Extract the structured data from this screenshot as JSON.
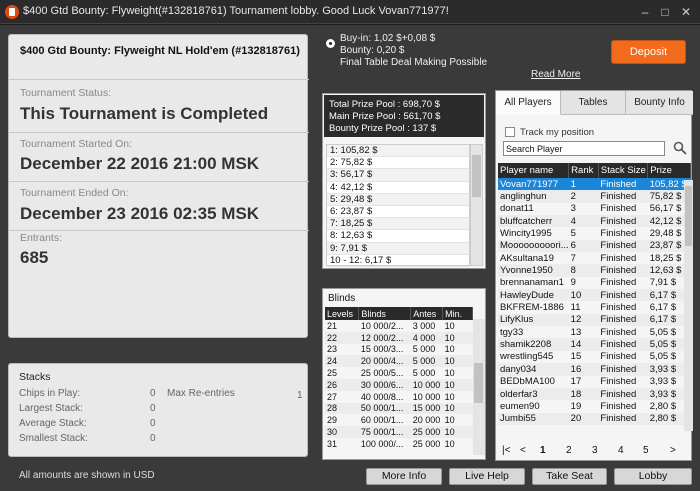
{
  "window": {
    "title": "$400 Gtd Bounty: Flyweight(#132818761) Tournament lobby. Good Luck Vovan771977!",
    "minimize": "–",
    "maximize": "□",
    "close": "✕"
  },
  "tournament": {
    "name": "$400 Gtd Bounty: Flyweight NL Hold'em (#132818761)",
    "status_label": "Tournament Status:",
    "status_value": "This Tournament is Completed",
    "started_label": "Tournament Started On:",
    "started_value": "December 22 2016   21:00 MSK",
    "ended_label": "Tournament Ended On:",
    "ended_value": "December 23 2016   02:35 MSK",
    "entrants_label": "Entrants:",
    "entrants_value": "685"
  },
  "stacks": {
    "title": "Stacks",
    "rows": [
      {
        "label": "Chips in Play:",
        "value": "0"
      },
      {
        "label": "Largest Stack:",
        "value": "0"
      },
      {
        "label": "Average Stack:",
        "value": "0"
      },
      {
        "label": "Smallest Stack:",
        "value": "0"
      }
    ],
    "max_reentries_label": "Max Re-entries",
    "max_reentries_value": "1"
  },
  "footer_note": "All amounts are shown in USD",
  "buttons": {
    "more_info": "More Info",
    "live_help": "Live Help",
    "take_seat": "Take Seat",
    "lobby": "Lobby",
    "deposit": "Deposit",
    "read_more": "Read More"
  },
  "buyin": {
    "line1": "Buy-in: 1,02 $+0,08 $",
    "line2": "Bounty: 0,20 $",
    "line3": "Final Table Deal Making Possible"
  },
  "prize": {
    "total": "Total Prize Pool : 698,70 $",
    "main": "Main Prize Pool : 561,70 $",
    "bounty": "Bounty Prize Pool : 137 $",
    "places": [
      "1: 105,82 $",
      "2: 75,82 $",
      "3: 56,17 $",
      "4: 42,12 $",
      "5: 29,48 $",
      "6: 23,87 $",
      "7: 18,25 $",
      "8: 12,63 $",
      "9: 7,91 $",
      "10 - 12: 6,17 $"
    ]
  },
  "blinds": {
    "title": "Blinds",
    "headers": [
      "Levels",
      "Blinds",
      "Antes",
      "Min."
    ],
    "rows": [
      [
        "21",
        "10 000/2...",
        "3 000",
        "10"
      ],
      [
        "22",
        "12 000/2...",
        "4 000",
        "10"
      ],
      [
        "23",
        "15 000/3...",
        "5 000",
        "10"
      ],
      [
        "24",
        "20 000/4...",
        "5 000",
        "10"
      ],
      [
        "25",
        "25 000/5...",
        "5 000",
        "10"
      ],
      [
        "26",
        "30 000/6...",
        "10 000",
        "10"
      ],
      [
        "27",
        "40 000/8...",
        "10 000",
        "10"
      ],
      [
        "28",
        "50 000/1...",
        "15 000",
        "10"
      ],
      [
        "29",
        "60 000/1...",
        "20 000",
        "10"
      ],
      [
        "30",
        "75 000/1...",
        "25 000",
        "10"
      ],
      [
        "31",
        "100 000/...",
        "25 000",
        "10"
      ]
    ]
  },
  "players_panel": {
    "tabs": [
      "All Players",
      "Tables",
      "Bounty Info"
    ],
    "track_label": "Track my position",
    "search_placeholder": "Search Player",
    "headers": [
      "Player name",
      "Rank",
      "Stack Size",
      "Prize"
    ],
    "rows": [
      [
        "Vovan771977",
        "1",
        "Finished",
        "105,82 $"
      ],
      [
        "anglinghun",
        "2",
        "Finished",
        "75,82 $"
      ],
      [
        "donat11",
        "3",
        "Finished",
        "56,17 $"
      ],
      [
        "bluffcatcherr",
        "4",
        "Finished",
        "42,12 $"
      ],
      [
        "Wincity1995",
        "5",
        "Finished",
        "29,48 $"
      ],
      [
        "Mooooooooori...",
        "6",
        "Finished",
        "23,87 $"
      ],
      [
        "AKsultana19",
        "7",
        "Finished",
        "18,25 $"
      ],
      [
        "Yvonne1950",
        "8",
        "Finished",
        "12,63 $"
      ],
      [
        "brennanaman1",
        "9",
        "Finished",
        "7,91 $"
      ],
      [
        "HawleyDude",
        "10",
        "Finished",
        "6,17 $"
      ],
      [
        "BKFREM-1886",
        "11",
        "Finished",
        "6,17 $"
      ],
      [
        "LifyKlus",
        "12",
        "Finished",
        "6,17 $"
      ],
      [
        "tgy33",
        "13",
        "Finished",
        "5,05 $"
      ],
      [
        "shamik2208",
        "14",
        "Finished",
        "5,05 $"
      ],
      [
        "wrestling545",
        "15",
        "Finished",
        "5,05 $"
      ],
      [
        "dany034",
        "16",
        "Finished",
        "3,93 $"
      ],
      [
        "BEDbMA100",
        "17",
        "Finished",
        "3,93 $"
      ],
      [
        "olderfar3",
        "18",
        "Finished",
        "3,93 $"
      ],
      [
        "eumen90",
        "19",
        "Finished",
        "2,80 $"
      ],
      [
        "Jumbi55",
        "20",
        "Finished",
        "2,80 $"
      ]
    ],
    "pager": [
      "|<",
      "<",
      "1",
      "2",
      "3",
      "4",
      "5",
      ">"
    ]
  }
}
